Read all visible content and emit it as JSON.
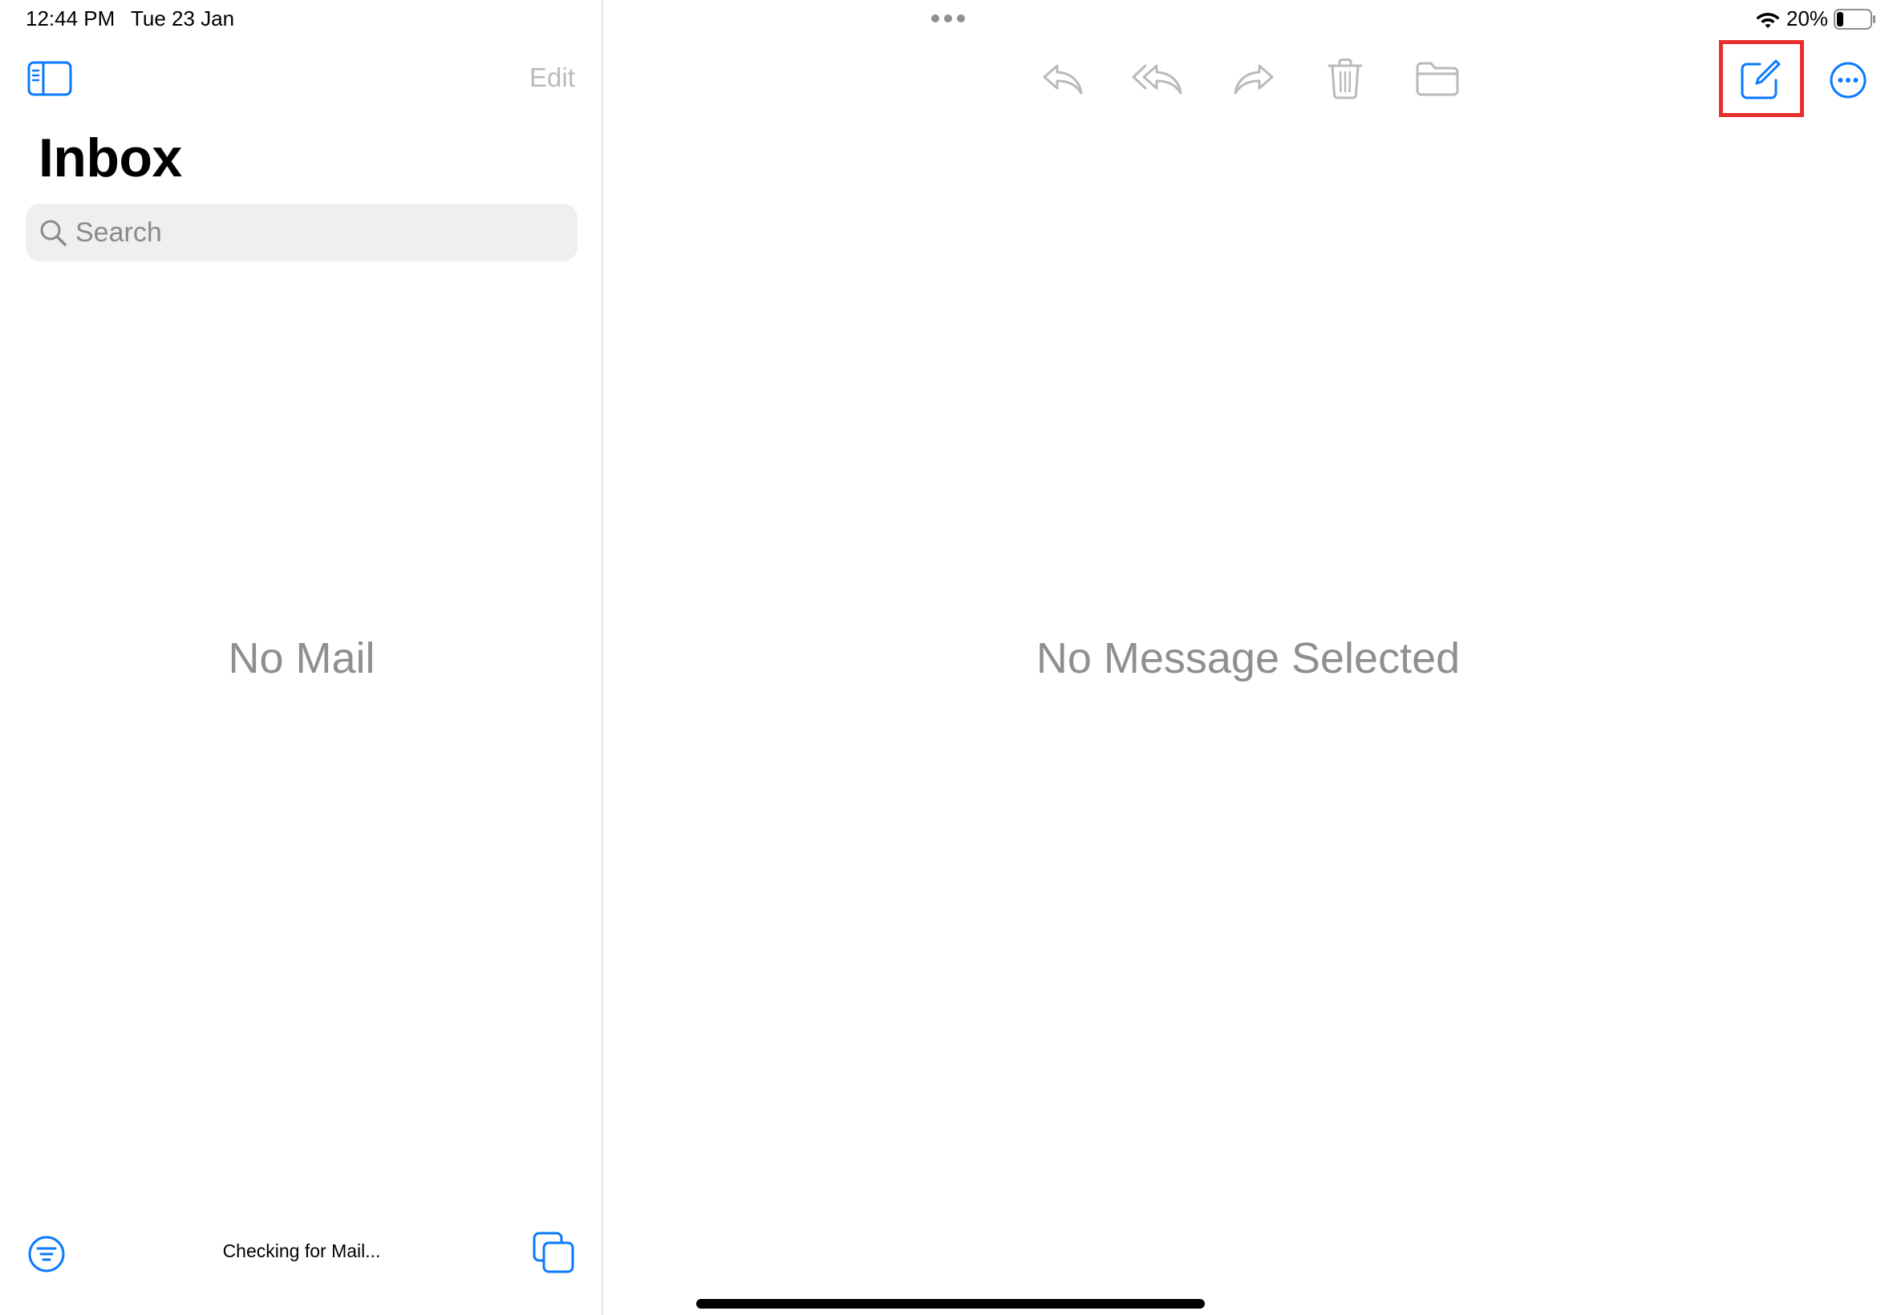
{
  "status_bar": {
    "time": "12:44 PM",
    "date": "Tue 23 Jan",
    "battery_percent": "20%",
    "battery_level": 0.2,
    "wifi_icon": "wifi-icon",
    "battery_icon": "battery-icon"
  },
  "sidebar": {
    "toggle_icon": "sidebar-toggle-icon",
    "edit_label": "Edit",
    "title": "Inbox",
    "search": {
      "placeholder": "Search",
      "value": ""
    },
    "empty_text": "No Mail",
    "footer": {
      "filter_icon": "filter-icon",
      "status_text": "Checking for Mail...",
      "windows_icon": "windows-icon"
    }
  },
  "detail": {
    "toolbar": {
      "reply_icon": "reply-icon",
      "reply_all_icon": "reply-all-icon",
      "forward_icon": "forward-icon",
      "trash_icon": "trash-icon",
      "folder_icon": "folder-icon",
      "compose_icon": "compose-icon",
      "more_icon": "more-icon"
    },
    "empty_text": "No Message Selected"
  },
  "colors": {
    "accent": "#0a7aff",
    "disabled": "#b9b9be",
    "placeholder_text": "#8e8e93",
    "highlight": "#e8302a"
  }
}
